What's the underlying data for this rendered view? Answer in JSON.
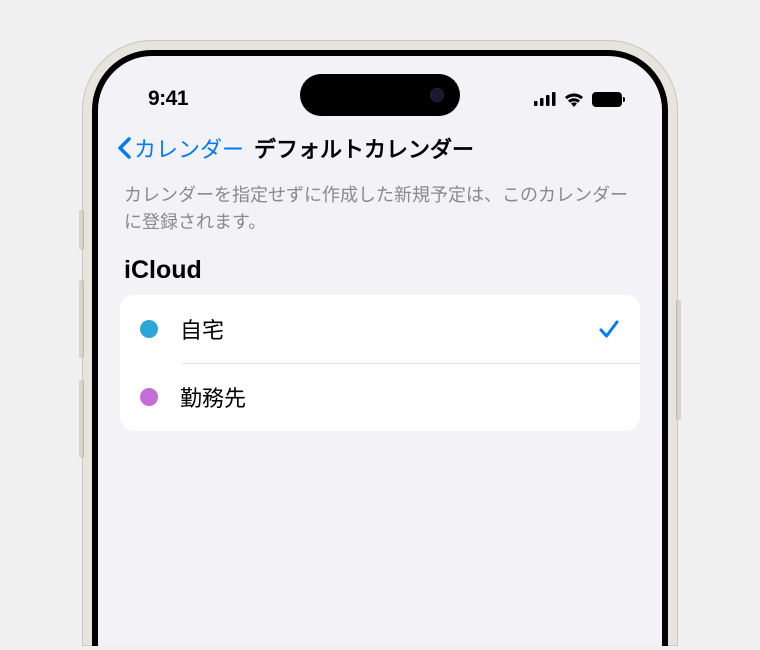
{
  "statusBar": {
    "time": "9:41"
  },
  "nav": {
    "back": "カレンダー",
    "title": "デフォルトカレンダー"
  },
  "description": "カレンダーを指定せずに作成した新規予定は、このカレンダーに登録されます。",
  "section": {
    "header": "iCloud",
    "items": [
      {
        "label": "自宅",
        "color": "#2aa6d9",
        "selected": true
      },
      {
        "label": "勤務先",
        "color": "#c56dd6",
        "selected": false
      }
    ]
  }
}
